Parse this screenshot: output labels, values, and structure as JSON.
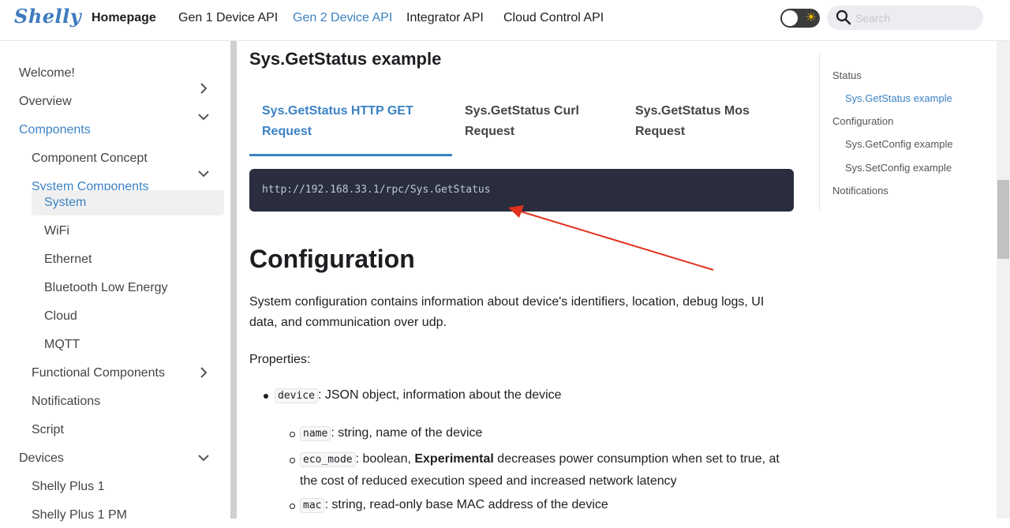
{
  "navbar": {
    "logo": "Shelly",
    "links": [
      "Homepage",
      "Gen 1 Device API",
      "Gen 2 Device API",
      "Integrator API",
      "Cloud Control API"
    ],
    "active_link": "Gen 2 Device API",
    "search_placeholder": "Search"
  },
  "sidebar": {
    "items": [
      {
        "label": "Welcome!"
      },
      {
        "label": "Overview",
        "chevron": "right"
      },
      {
        "label": "Components",
        "chevron": "down",
        "active": true
      },
      {
        "label": "Component Concept"
      },
      {
        "label": "System Components",
        "chevron": "down",
        "active": true
      },
      {
        "label": "System",
        "selected": true
      },
      {
        "label": "WiFi"
      },
      {
        "label": "Ethernet"
      },
      {
        "label": "Bluetooth Low Energy"
      },
      {
        "label": "Cloud"
      },
      {
        "label": "MQTT"
      },
      {
        "label": "Functional Components",
        "chevron": "right"
      },
      {
        "label": "Notifications"
      },
      {
        "label": "Script"
      },
      {
        "label": "Devices",
        "chevron": "down"
      },
      {
        "label": "Shelly Plus 1"
      },
      {
        "label": "Shelly Plus 1 PM"
      }
    ]
  },
  "main": {
    "example_heading": "Sys.GetStatus example",
    "tabs": [
      {
        "line1": "Sys.GetStatus HTTP GET",
        "line2": "Request"
      },
      {
        "line1": "Sys.GetStatus Curl",
        "line2": "Request"
      },
      {
        "line1": "Sys.GetStatus Mos",
        "line2": "Request"
      }
    ],
    "code": "http://192.168.33.1/rpc/Sys.GetStatus",
    "config_heading": "Configuration",
    "config_paragraph": "System configuration contains information about device's identifiers, location, debug logs, UI data, and communication over udp.",
    "properties_label": "Properties:",
    "device_prop": {
      "code": "device",
      "text": ": JSON object, information about the device"
    },
    "sub_props": {
      "name": {
        "code": "name",
        "text": ": string, name of the device"
      },
      "eco_mode": {
        "code": "eco_mode",
        "text_before": ": boolean, ",
        "bold": "Experimental",
        "text_after": " decreases power consumption when set to true, at",
        "line2": "the cost of reduced execution speed and increased network latency"
      },
      "mac": {
        "code": "mac",
        "text": ": string, read-only base MAC address of the device"
      }
    }
  },
  "toc": {
    "items": [
      {
        "label": "Status"
      },
      {
        "label": "Sys.GetStatus example",
        "active": true
      },
      {
        "label": "Configuration"
      },
      {
        "label": "Sys.GetConfig example"
      },
      {
        "label": "Sys.SetConfig example"
      },
      {
        "label": "Notifications"
      }
    ]
  },
  "colors": {
    "accent": "#3b82c4",
    "code_bg": "#292d3e",
    "arrow": "#e0311e"
  }
}
